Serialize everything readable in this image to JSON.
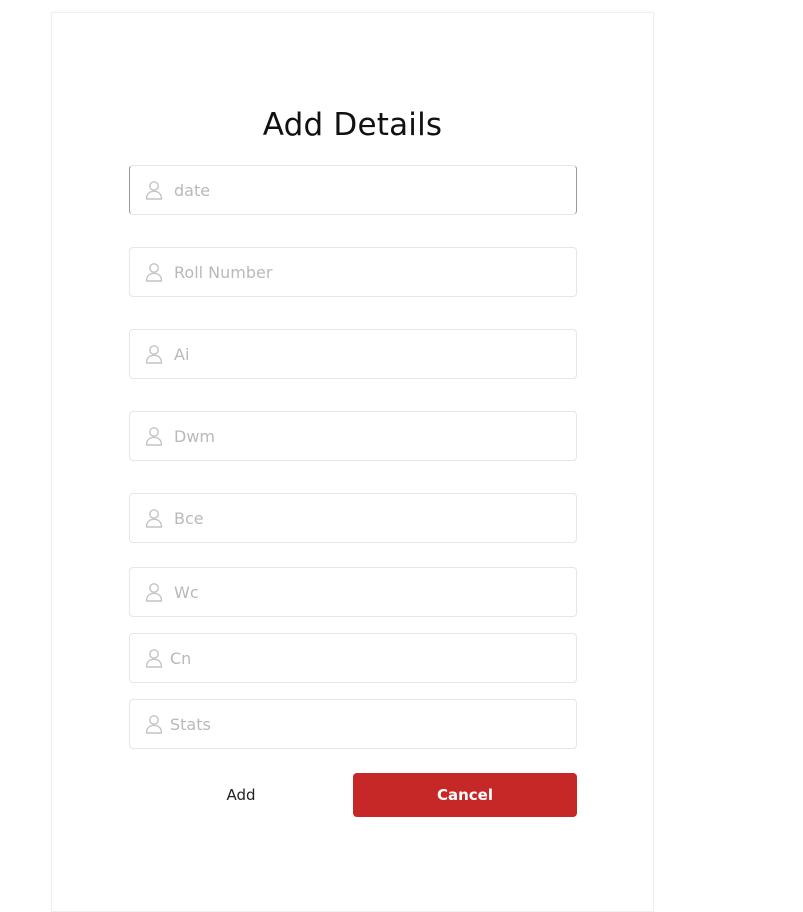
{
  "form": {
    "title": "Add Details",
    "fields": [
      {
        "placeholder": "date",
        "value": ""
      },
      {
        "placeholder": "Roll Number",
        "value": ""
      },
      {
        "placeholder": "Ai",
        "value": ""
      },
      {
        "placeholder": "Dwm",
        "value": ""
      },
      {
        "placeholder": "Bce",
        "value": ""
      },
      {
        "placeholder": "Wc",
        "value": ""
      },
      {
        "placeholder": "Cn",
        "value": ""
      },
      {
        "placeholder": "Stats",
        "value": ""
      }
    ],
    "icon": "user-icon",
    "add_label": "Add",
    "cancel_label": "Cancel"
  },
  "colors": {
    "accent": "#c62828",
    "placeholder": "#b9b9b9",
    "border": "#e6e6e6"
  }
}
